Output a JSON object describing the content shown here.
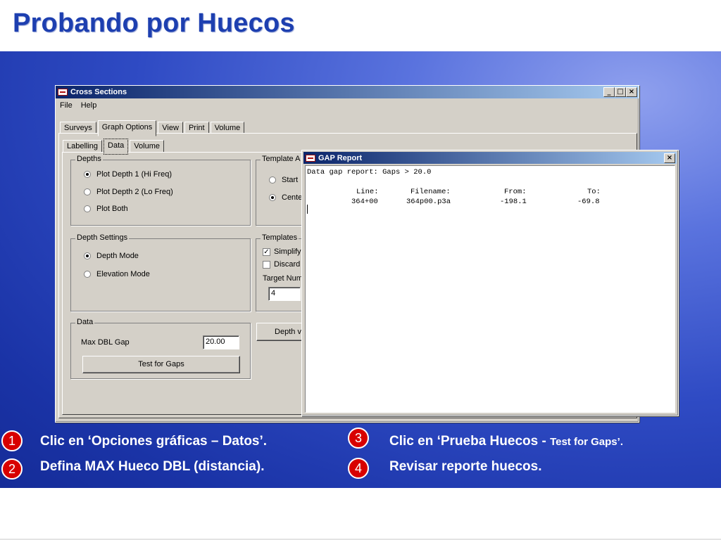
{
  "slide": {
    "title": "Probando por Huecos",
    "steps": [
      {
        "num": "1",
        "text": "Clic en ‘Opciones gráficas – Datos’."
      },
      {
        "num": "2",
        "text": "Defina MAX Hueco DBL (distancia)."
      },
      {
        "num": "3",
        "text": "Clic en ‘Prueba Huecos - ",
        "small": "Test for Gaps’."
      },
      {
        "num": "4",
        "text": "Revisar reporte huecos."
      }
    ]
  },
  "cross_window": {
    "title": "Cross  Sections",
    "buttons": {
      "minimize": "_",
      "maximize": "□",
      "close": "×"
    },
    "menu": [
      "File",
      "Help"
    ],
    "tabs": [
      "Surveys",
      "Graph Options",
      "View",
      "Print",
      "Volume"
    ],
    "subtabs": [
      "Labelling",
      "Data",
      "Volume"
    ],
    "depths": {
      "label": "Depths",
      "options": [
        "Plot Depth 1 (Hi Freq)",
        "Plot Depth 2 (Lo Freq)",
        "Plot Both"
      ]
    },
    "depth_settings": {
      "label": "Depth Settings",
      "options": [
        "Depth Mode",
        "Elevation Mode"
      ]
    },
    "data_group": {
      "label": "Data",
      "max_dbl_gap_label": "Max DBL Gap",
      "max_dbl_gap_value": "20.00",
      "test_button": "Test for Gaps"
    },
    "template_group": {
      "label": "Template A",
      "options": [
        "Start",
        "Cente"
      ]
    },
    "templates_group": {
      "label": "Templates",
      "checks": [
        {
          "label": "Simplify",
          "checked": true
        },
        {
          "label": "Discard",
          "checked": false
        }
      ],
      "target_label": "Target Num",
      "target_value": "4"
    },
    "depth_button": "Depth v"
  },
  "gap_window": {
    "title": "GAP Report",
    "close": "×",
    "header_line": "Data gap report: Gaps > 20.0",
    "columns": [
      "Line:",
      "Filename:",
      "From:",
      "To:"
    ],
    "rows": [
      [
        "364+00",
        "364p00.p3a",
        "-198.1",
        "-69.8"
      ]
    ]
  }
}
